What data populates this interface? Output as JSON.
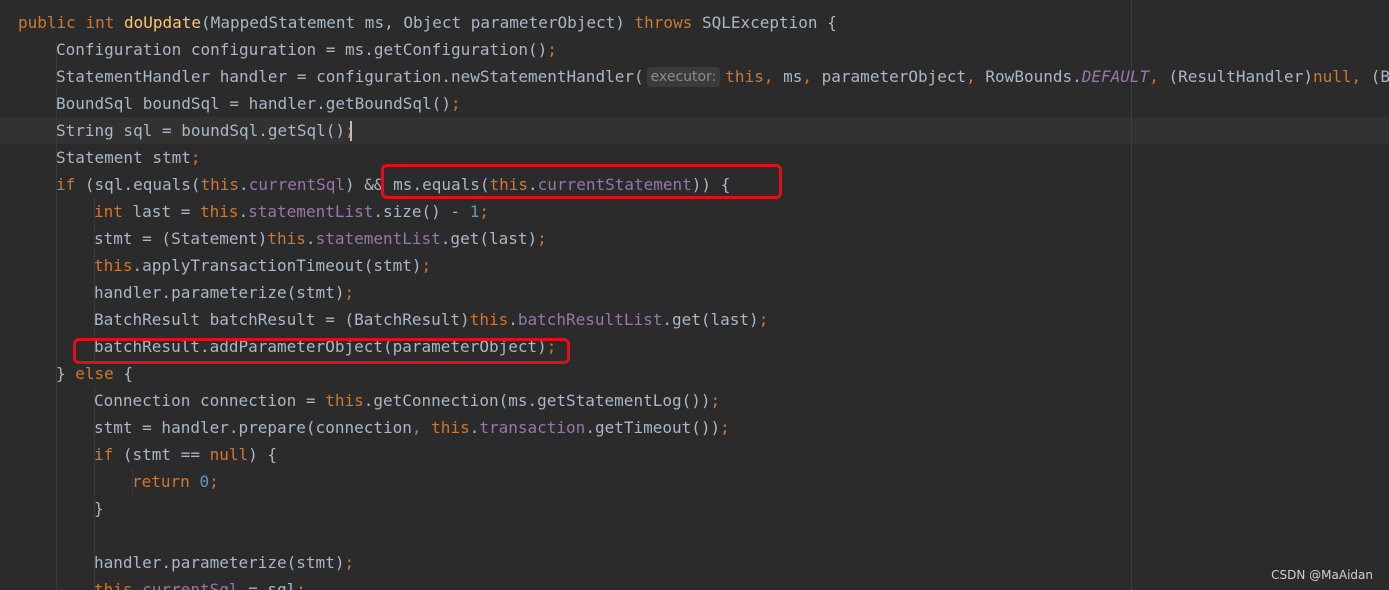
{
  "editor": {
    "background": "#2b2b2b",
    "colors": {
      "keyword": "#cc7832",
      "method_declaration": "#ffc66d",
      "field": "#9876aa",
      "number": "#6897bb",
      "plain": "#a9b7c6",
      "highlight_box": "#e0101b"
    },
    "lines": [
      {
        "indent": 0,
        "tokens": [
          {
            "t": "public",
            "c": "kw"
          },
          {
            "t": " "
          },
          {
            "t": "int",
            "c": "kw"
          },
          {
            "t": " "
          },
          {
            "t": "doUpdate",
            "c": "fn"
          },
          {
            "t": "(MappedStatement ms, Object parameterObject) "
          },
          {
            "t": "throws",
            "c": "kw"
          },
          {
            "t": " SQLException {"
          }
        ]
      },
      {
        "indent": 1,
        "tokens": [
          {
            "t": "Configuration configuration = ms.getConfiguration()"
          },
          {
            "t": ";",
            "c": "kw"
          }
        ]
      },
      {
        "indent": 1,
        "tokens": [
          {
            "t": "StatementHandler handler = configuration.newStatementHandler("
          },
          {
            "hint": "executor:"
          },
          {
            "t": "this",
            "c": "kw"
          },
          {
            "t": ",",
            "c": "kw"
          },
          {
            "t": " ms"
          },
          {
            "t": ",",
            "c": "kw"
          },
          {
            "t": " parameterObject"
          },
          {
            "t": ",",
            "c": "kw"
          },
          {
            "t": " RowBounds."
          },
          {
            "t": "DEFAULT",
            "c": "static-f"
          },
          {
            "t": ",",
            "c": "kw"
          },
          {
            "t": " (ResultHandler)"
          },
          {
            "t": "null",
            "c": "kw"
          },
          {
            "t": ",",
            "c": "kw"
          },
          {
            "t": " (Bo"
          }
        ]
      },
      {
        "indent": 1,
        "tokens": [
          {
            "t": "BoundSql boundSql = handler.getBoundSql()"
          },
          {
            "t": ";",
            "c": "kw"
          }
        ]
      },
      {
        "indent": 1,
        "tokens": [
          {
            "t": "String sql = boundSql.getSql()"
          },
          {
            "t": ";",
            "c": "kw"
          }
        ]
      },
      {
        "indent": 1,
        "tokens": [
          {
            "t": "Statement stmt"
          },
          {
            "t": ";",
            "c": "kw"
          }
        ]
      },
      {
        "indent": 1,
        "tokens": [
          {
            "t": "if",
            "c": "kw"
          },
          {
            "t": " (sql.equals("
          },
          {
            "t": "this",
            "c": "kw"
          },
          {
            "t": "."
          },
          {
            "t": "currentSql",
            "c": "field"
          },
          {
            "t": ") && ms.equals("
          },
          {
            "t": "this",
            "c": "kw"
          },
          {
            "t": "."
          },
          {
            "t": "currentStatement",
            "c": "field"
          },
          {
            "t": ")) {"
          }
        ]
      },
      {
        "indent": 2,
        "tokens": [
          {
            "t": "int",
            "c": "kw"
          },
          {
            "t": " last = "
          },
          {
            "t": "this",
            "c": "kw"
          },
          {
            "t": "."
          },
          {
            "t": "statementList",
            "c": "field"
          },
          {
            "t": ".size() - "
          },
          {
            "t": "1",
            "c": "num"
          },
          {
            "t": ";",
            "c": "kw"
          }
        ]
      },
      {
        "indent": 2,
        "tokens": [
          {
            "t": "stmt = (Statement)"
          },
          {
            "t": "this",
            "c": "kw"
          },
          {
            "t": "."
          },
          {
            "t": "statementList",
            "c": "field"
          },
          {
            "t": ".get(last)"
          },
          {
            "t": ";",
            "c": "kw"
          }
        ]
      },
      {
        "indent": 2,
        "tokens": [
          {
            "t": "this",
            "c": "kw"
          },
          {
            "t": ".applyTransactionTimeout(stmt)"
          },
          {
            "t": ";",
            "c": "kw"
          }
        ]
      },
      {
        "indent": 2,
        "tokens": [
          {
            "t": "handler.parameterize(stmt)"
          },
          {
            "t": ";",
            "c": "kw"
          }
        ]
      },
      {
        "indent": 2,
        "tokens": [
          {
            "t": "BatchResult batchResult = (BatchResult)"
          },
          {
            "t": "this",
            "c": "kw"
          },
          {
            "t": "."
          },
          {
            "t": "batchResultList",
            "c": "field"
          },
          {
            "t": ".get(last)"
          },
          {
            "t": ";",
            "c": "kw"
          }
        ]
      },
      {
        "indent": 2,
        "tokens": [
          {
            "t": "batchResult.addParameterObject(parameterObject)"
          },
          {
            "t": ";",
            "c": "kw"
          }
        ]
      },
      {
        "indent": 1,
        "tokens": [
          {
            "t": "} "
          },
          {
            "t": "else",
            "c": "kw"
          },
          {
            "t": " {"
          }
        ]
      },
      {
        "indent": 2,
        "tokens": [
          {
            "t": "Connection connection = "
          },
          {
            "t": "this",
            "c": "kw"
          },
          {
            "t": ".getConnection(ms.getStatementLog())"
          },
          {
            "t": ";",
            "c": "kw"
          }
        ]
      },
      {
        "indent": 2,
        "tokens": [
          {
            "t": "stmt = handler.prepare(connection"
          },
          {
            "t": ",",
            "c": "kw"
          },
          {
            "t": " "
          },
          {
            "t": "this",
            "c": "kw"
          },
          {
            "t": "."
          },
          {
            "t": "transaction",
            "c": "field"
          },
          {
            "t": ".getTimeout())"
          },
          {
            "t": ";",
            "c": "kw"
          }
        ]
      },
      {
        "indent": 2,
        "tokens": [
          {
            "t": "if",
            "c": "kw"
          },
          {
            "t": " (stmt == "
          },
          {
            "t": "null",
            "c": "kw"
          },
          {
            "t": ") {"
          }
        ]
      },
      {
        "indent": 3,
        "tokens": [
          {
            "t": "return",
            "c": "kw"
          },
          {
            "t": " "
          },
          {
            "t": "0",
            "c": "num"
          },
          {
            "t": ";",
            "c": "kw"
          }
        ]
      },
      {
        "indent": 2,
        "tokens": [
          {
            "t": "}"
          }
        ]
      },
      {
        "indent": 0,
        "tokens": []
      },
      {
        "indent": 2,
        "tokens": [
          {
            "t": "handler.parameterize(stmt)"
          },
          {
            "t": ";",
            "c": "kw"
          }
        ]
      },
      {
        "indent": 2,
        "tokens": [
          {
            "t": "this",
            "c": "kw"
          },
          {
            "t": "."
          },
          {
            "t": "currentSql",
            "c": "field"
          },
          {
            "t": " = sql"
          },
          {
            "t": ";",
            "c": "kw"
          }
        ]
      }
    ]
  },
  "watermark": "CSDN @MaAidan"
}
